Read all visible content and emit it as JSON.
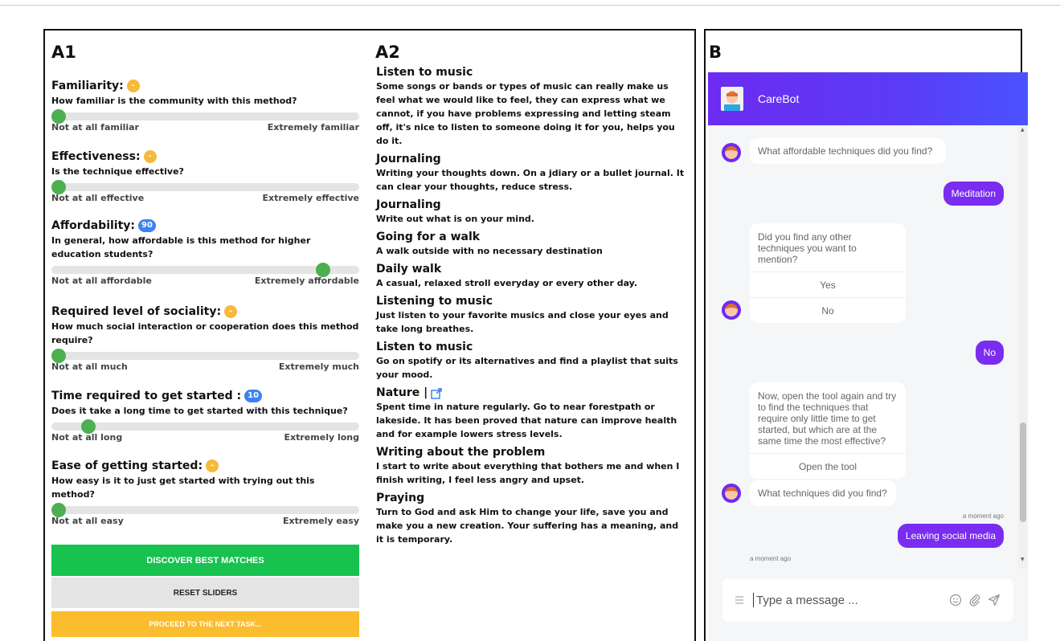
{
  "labels": {
    "a1": "A1",
    "a2": "A2",
    "b": "B"
  },
  "sliders": [
    {
      "title": "Familiarity:",
      "badge": "-",
      "badge_color": "orange",
      "question": "How familiar is the community with this method?",
      "min_label": "Not at all familiar",
      "max_label": "Extremely familiar",
      "value": 0
    },
    {
      "title": "Effectiveness:",
      "badge": "-",
      "badge_color": "orange",
      "question": "Is the technique effective?",
      "min_label": "Not at all effective",
      "max_label": "Extremely effective",
      "value": 0
    },
    {
      "title": "Affordability:",
      "badge": "90",
      "badge_color": "blue",
      "question": "In general, how affordable is this method for higher education students?",
      "min_label": "Not at all affordable",
      "max_label": "Extremely affordable",
      "value": 90
    },
    {
      "title": "Required level of sociality:",
      "badge": "-",
      "badge_color": "orange",
      "question": "How much social interaction or cooperation does this method require?",
      "min_label": "Not at all much",
      "max_label": "Extremely much",
      "value": 0
    },
    {
      "title": "Time required to get started :",
      "badge": "10",
      "badge_color": "blue",
      "question": "Does it take a long time to get started with this technique?",
      "min_label": "Not at all long",
      "max_label": "Extremely long",
      "value": 10
    },
    {
      "title": "Ease of getting started:",
      "badge": "-",
      "badge_color": "orange",
      "question": "How easy is it to just get started with trying out this method?",
      "min_label": "Not at all easy",
      "max_label": "Extremely easy",
      "value": 0
    }
  ],
  "buttons": {
    "discover": "DISCOVER BEST MATCHES",
    "reset": "RESET SLIDERS",
    "proceed": "PROCEED TO THE NEXT TASK..."
  },
  "techniques": [
    {
      "title": "Listen to music",
      "desc": "Some songs or bands or types of music can really make us feel what we would like to feel, they can express what we cannot, if you have problems expressing and letting steam off, it's nice to listen to someone doing it for you, helps you do it."
    },
    {
      "title": "Journaling",
      "desc": "Writing your thoughts down. On a jdiary or a bullet journal. It can clear your thoughts, reduce stress."
    },
    {
      "title": "Journaling",
      "desc": "Write out what is on your mind."
    },
    {
      "title": "Going for a walk",
      "desc": "A walk outside with no necessary destination"
    },
    {
      "title": "Daily walk",
      "desc": "A casual, relaxed stroll everyday or every other day."
    },
    {
      "title": "Listening to music",
      "desc": "Just listen to your favorite musics and close your eyes and take long breathes."
    },
    {
      "title": "Listen to music",
      "desc": "Go on spotify or its alternatives and find a playlist that suits your mood."
    },
    {
      "title": "Nature |",
      "desc": "Spent time in nature regularly. Go to near forestpath or lakeside. It has been proved that nature can improve health and for example lowers stress levels.",
      "link": true
    },
    {
      "title": "Writing about the problem",
      "desc": "I start to write about everything that bothers me and when I finish writing, I feel less angry and upset."
    },
    {
      "title": "Praying",
      "desc": "Turn to God and ask Him to change your life, save you and make you a new creation. Your suffering has a meaning, and it is temporary."
    }
  ],
  "chat": {
    "bot_name": "CareBot",
    "msg1": "What affordable techniques did you find?",
    "user1": "Meditation",
    "card1_text": "Did you find any other techniques you want to mention?",
    "card1_opt1": "Yes",
    "card1_opt2": "No",
    "user2": "No",
    "card2_text": "Now, open the tool again and try to find the techniques that require only little time to get started, but which are at the same time the most effective?",
    "card2_opt1": "Open the tool",
    "msg2": "What techniques did you find?",
    "time1": "a moment ago",
    "user3": "Leaving social media",
    "time2": "a moment ago",
    "input_placeholder": "Type a message ..."
  },
  "colors": {
    "accent": "#7a2cf0",
    "green": "#17c24f",
    "yellow": "#fbbc2e",
    "thumb": "#4caf50"
  }
}
